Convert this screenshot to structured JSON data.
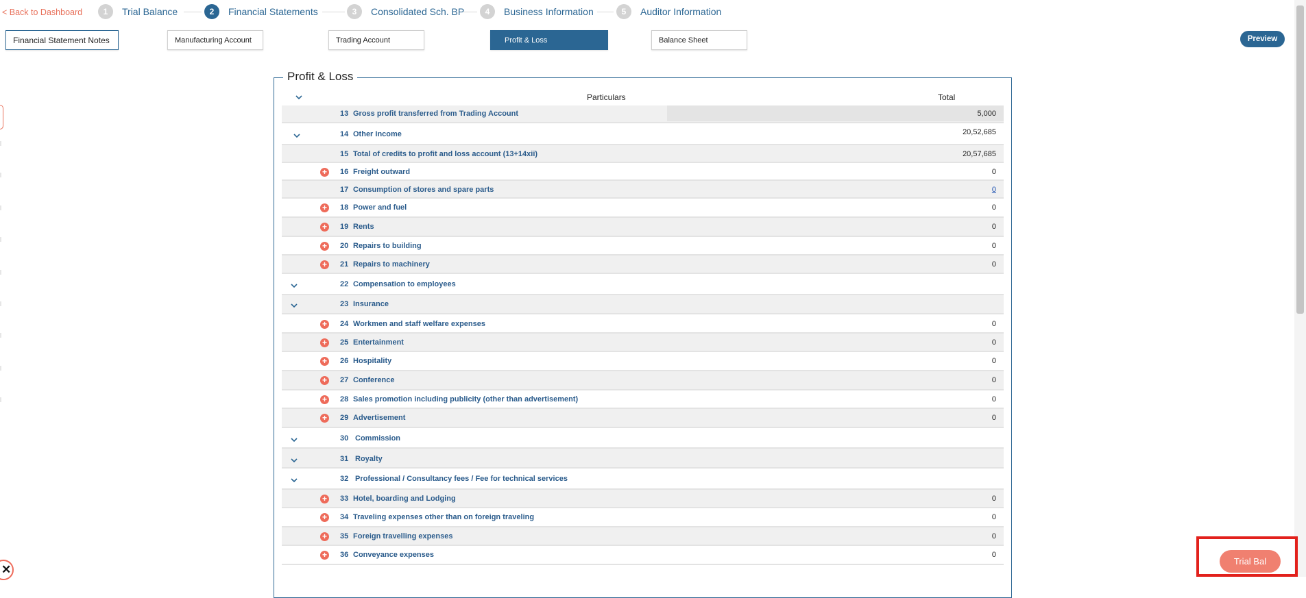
{
  "nav": {
    "back_label": "< Back to Dashboard",
    "steps": [
      {
        "num": "1",
        "label": "Trial Balance"
      },
      {
        "num": "2",
        "label": "Financial Statements"
      },
      {
        "num": "3",
        "label": "Consolidated Sch. BP"
      },
      {
        "num": "4",
        "label": "Business Information"
      },
      {
        "num": "5",
        "label": "Auditor Information"
      }
    ]
  },
  "subtabs": [
    "Financial Statement Notes",
    "Manufacturing Account",
    "Trading Account",
    "Profit & Loss",
    "Balance Sheet"
  ],
  "preview_label": "Preview",
  "section": {
    "title": "Profit & Loss",
    "col_particulars": "Particulars",
    "col_total": "Total",
    "rows": [
      {
        "num": "13",
        "label": "Gross profit transferred from Trading Account",
        "value": "5,000"
      },
      {
        "num": "14",
        "label": "Other Income",
        "value": "20,52,685"
      },
      {
        "num": "15",
        "label": "Total of credits to profit and loss account (13+14xii)",
        "value": "20,57,685"
      },
      {
        "num": "16",
        "label": "Freight outward",
        "value": "0"
      },
      {
        "num": "17",
        "label": "Consumption of stores and spare parts",
        "value": "0"
      },
      {
        "num": "18",
        "label": "Power and fuel",
        "value": "0"
      },
      {
        "num": "19",
        "label": "Rents",
        "value": "0"
      },
      {
        "num": "20",
        "label": "Repairs to building",
        "value": "0"
      },
      {
        "num": "21",
        "label": "Repairs to machinery",
        "value": "0"
      },
      {
        "num": "22",
        "label": "Compensation to employees",
        "value": ""
      },
      {
        "num": "23",
        "label": "Insurance",
        "value": ""
      },
      {
        "num": "24",
        "label": "Workmen and staff welfare expenses",
        "value": "0"
      },
      {
        "num": "25",
        "label": "Entertainment",
        "value": "0"
      },
      {
        "num": "26",
        "label": "Hospitality",
        "value": "0"
      },
      {
        "num": "27",
        "label": "Conference",
        "value": "0"
      },
      {
        "num": "28",
        "label": "Sales promotion including publicity (other than advertisement)",
        "value": "0"
      },
      {
        "num": "29",
        "label": "Advertisement",
        "value": "0"
      },
      {
        "num": "30",
        "label": "Commission",
        "value": ""
      },
      {
        "num": "31",
        "label": "Royalty",
        "value": ""
      },
      {
        "num": "32",
        "label": "Professional / Consultancy fees / Fee for technical services",
        "value": ""
      },
      {
        "num": "33",
        "label": "Hotel, boarding and Lodging",
        "value": "0"
      },
      {
        "num": "34",
        "label": "Traveling expenses other than on foreign traveling",
        "value": "0"
      },
      {
        "num": "35",
        "label": "Foreign travelling expenses",
        "value": "0"
      },
      {
        "num": "36",
        "label": "Conveyance expenses",
        "value": "0"
      }
    ]
  },
  "trial_bal_label": "Trial Bal",
  "colors": {
    "primary": "#2b6693",
    "accent": "#ee6b5a",
    "highlight": "#e2211c"
  }
}
